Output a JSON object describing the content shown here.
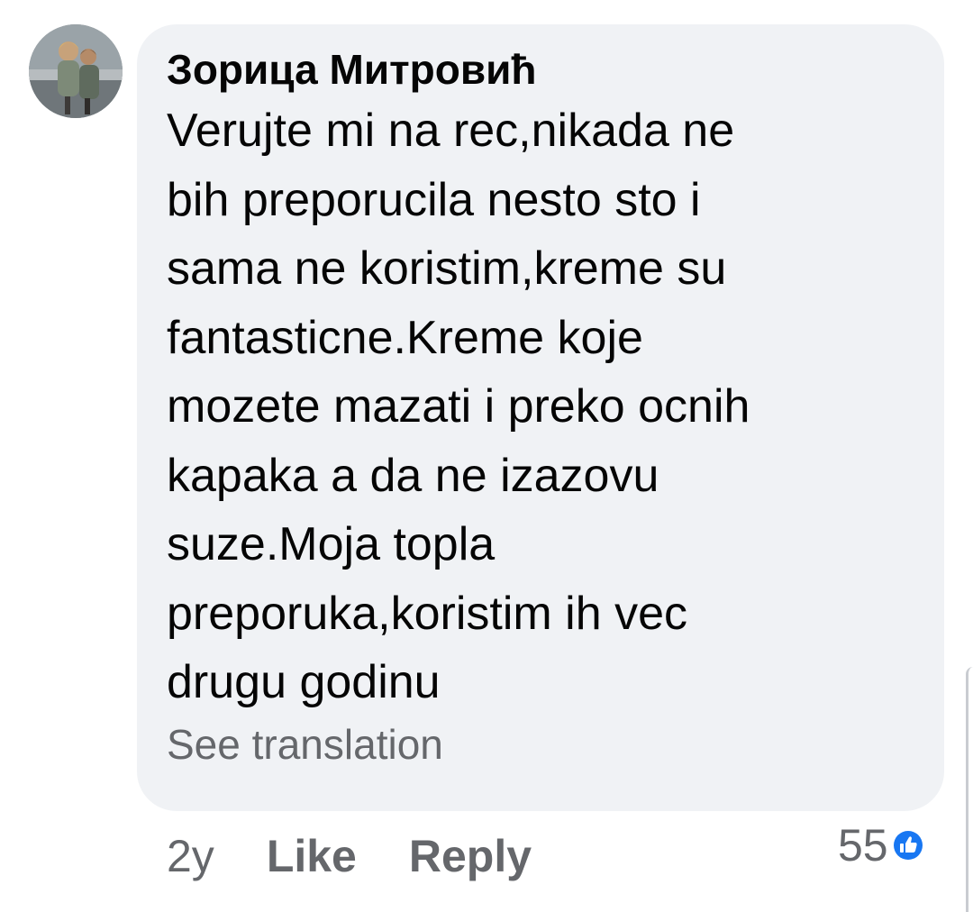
{
  "comment": {
    "author": "Зорица Митровић",
    "lines": [
      "Verujte mi na rec,nikada ne",
      "bih preporucila nesto sto i",
      "sama ne koristim,kreme su",
      "fantasticne.Kreme koje",
      "mozete mazati i preko ocnih",
      "kapaka a da ne izazovu",
      "suze.Moja topla",
      "preporuka,koristim ih vec",
      "drugu godinu"
    ],
    "see_translation": "See translation"
  },
  "actions": {
    "time": "2y",
    "like": "Like",
    "reply": "Reply"
  },
  "reactions": {
    "count": "55",
    "icon": "thumbs-up-icon",
    "color": "#1877f2"
  },
  "colors": {
    "bubble": "#f0f2f5",
    "text": "#050505",
    "secondary": "#65676b"
  }
}
